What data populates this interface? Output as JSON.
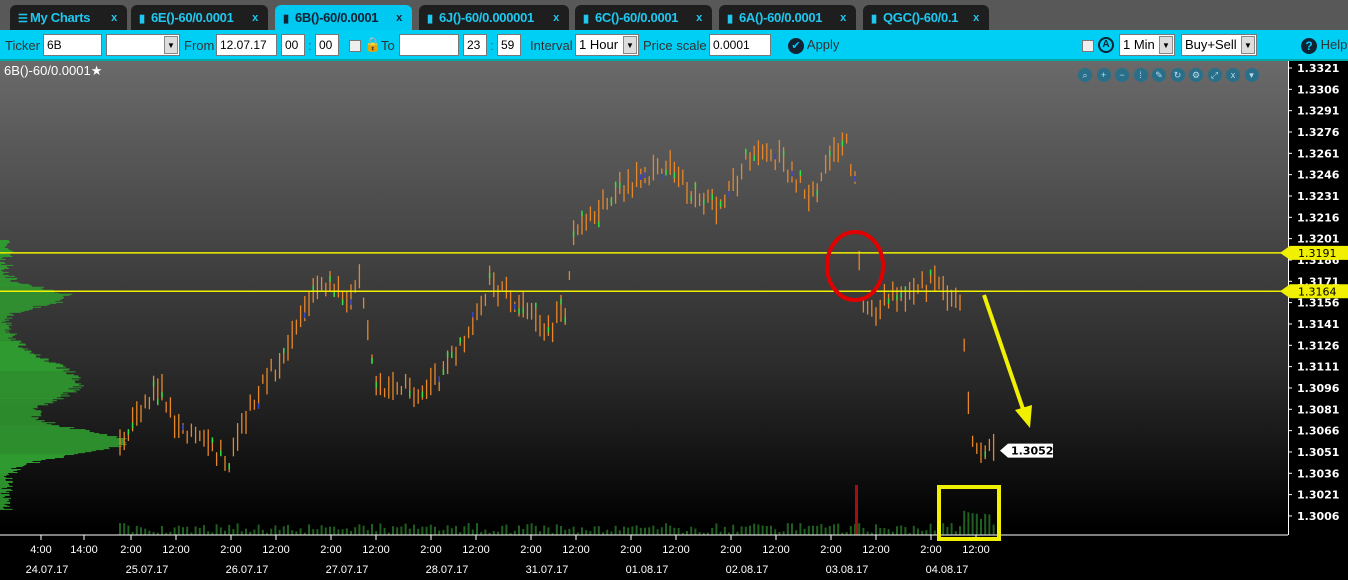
{
  "tabs": [
    {
      "label": "My Charts",
      "icon": "menu-icon",
      "active": false
    },
    {
      "label": "6E()-60/0.0001",
      "icon": "bar-chart-icon",
      "active": false
    },
    {
      "label": "6B()-60/0.0001",
      "icon": "bar-chart-icon",
      "active": true
    },
    {
      "label": "6J()-60/0.000001",
      "icon": "bar-chart-icon",
      "active": false
    },
    {
      "label": "6C()-60/0.0001",
      "icon": "bar-chart-icon",
      "active": false
    },
    {
      "label": "6A()-60/0.0001",
      "icon": "bar-chart-icon",
      "active": false
    },
    {
      "label": "QGC()-60/0.1",
      "icon": "bar-chart-icon",
      "active": false
    }
  ],
  "tab_close": "x",
  "toolbar": {
    "ticker_label": "Ticker",
    "ticker_value": "6B",
    "ticker_select": "",
    "from_label": "From",
    "from_date": "12.07.17",
    "from_hour": "00",
    "from_min": "00",
    "to_label": "To",
    "to_date": "",
    "to_hour": "23",
    "to_min": "59",
    "colon": ":",
    "interval_label": "Interval",
    "interval_value": "1 Hour",
    "price_scale_label": "Price scale",
    "price_scale_value": "0.0001",
    "apply_label": "Apply",
    "timeframe_value": "1 Min",
    "side_value": "Buy+Sell",
    "help_label": "Help"
  },
  "chart": {
    "title": "6B()-60/0.0001",
    "colors": {
      "up": "#e8872a",
      "down": "#33dd44",
      "line": "#f0f000",
      "circle": "#e00000"
    },
    "chart_data": {
      "type": "bar",
      "price_ticks": [
        "1.3321",
        "1.3306",
        "1.3291",
        "1.3276",
        "1.3261",
        "1.3246",
        "1.3231",
        "1.3216",
        "1.3201",
        "1.3186",
        "1.3171",
        "1.3156",
        "1.3141",
        "1.3126",
        "1.3111",
        "1.3096",
        "1.3081",
        "1.3066",
        "1.3051",
        "1.3036",
        "1.3021",
        "1.3006"
      ],
      "ylim": [
        1.3006,
        1.3321
      ],
      "time_ticks": [
        "4:00",
        "14:00",
        "2:00",
        "12:00",
        "2:00",
        "12:00",
        "2:00",
        "12:00",
        "2:00",
        "12:00",
        "2:00",
        "12:00",
        "2:00",
        "12:00",
        "2:00",
        "12:00",
        "2:00",
        "12:00",
        "2:00",
        "12:00"
      ],
      "date_ticks": [
        "24.07.17",
        "25.07.17",
        "26.07.17",
        "27.07.17",
        "28.07.17",
        "31.07.17",
        "01.08.17",
        "02.08.17",
        "03.08.17",
        "04.08.17"
      ],
      "price_path_days": [
        [
          1.2,
          1.3055
        ],
        [
          1.6,
          1.3098
        ],
        [
          1.75,
          1.307
        ],
        [
          2.3,
          1.3045
        ],
        [
          2.5,
          1.3085
        ],
        [
          2.85,
          1.312
        ],
        [
          3.2,
          1.317
        ],
        [
          3.45,
          1.316
        ],
        [
          3.6,
          1.3172
        ],
        [
          3.75,
          1.3095
        ],
        [
          4.3,
          1.3095
        ],
        [
          4.7,
          1.3135
        ],
        [
          4.9,
          1.317
        ],
        [
          5.2,
          1.3155
        ],
        [
          5.45,
          1.3135
        ],
        [
          5.65,
          1.315
        ],
        [
          5.75,
          1.321
        ],
        [
          6.0,
          1.3225
        ],
        [
          6.4,
          1.3245
        ],
        [
          6.7,
          1.325
        ],
        [
          7.0,
          1.323
        ],
        [
          7.2,
          1.322
        ],
        [
          7.5,
          1.326
        ],
        [
          7.8,
          1.3258
        ],
        [
          8.1,
          1.323
        ],
        [
          8.45,
          1.3275
        ],
        [
          8.55,
          1.324
        ],
        [
          8.58,
          1.3195
        ],
        [
          8.62,
          1.315
        ],
        [
          8.7,
          1.3145
        ],
        [
          8.9,
          1.316
        ],
        [
          9.4,
          1.317
        ],
        [
          9.6,
          1.3155
        ],
        [
          9.65,
          1.3115
        ],
        [
          9.72,
          1.3065
        ],
        [
          9.85,
          1.305
        ],
        [
          9.95,
          1.3055
        ]
      ],
      "horizontal_levels": [
        "1.3191",
        "1.3164"
      ],
      "last_price": "1.3052"
    }
  }
}
